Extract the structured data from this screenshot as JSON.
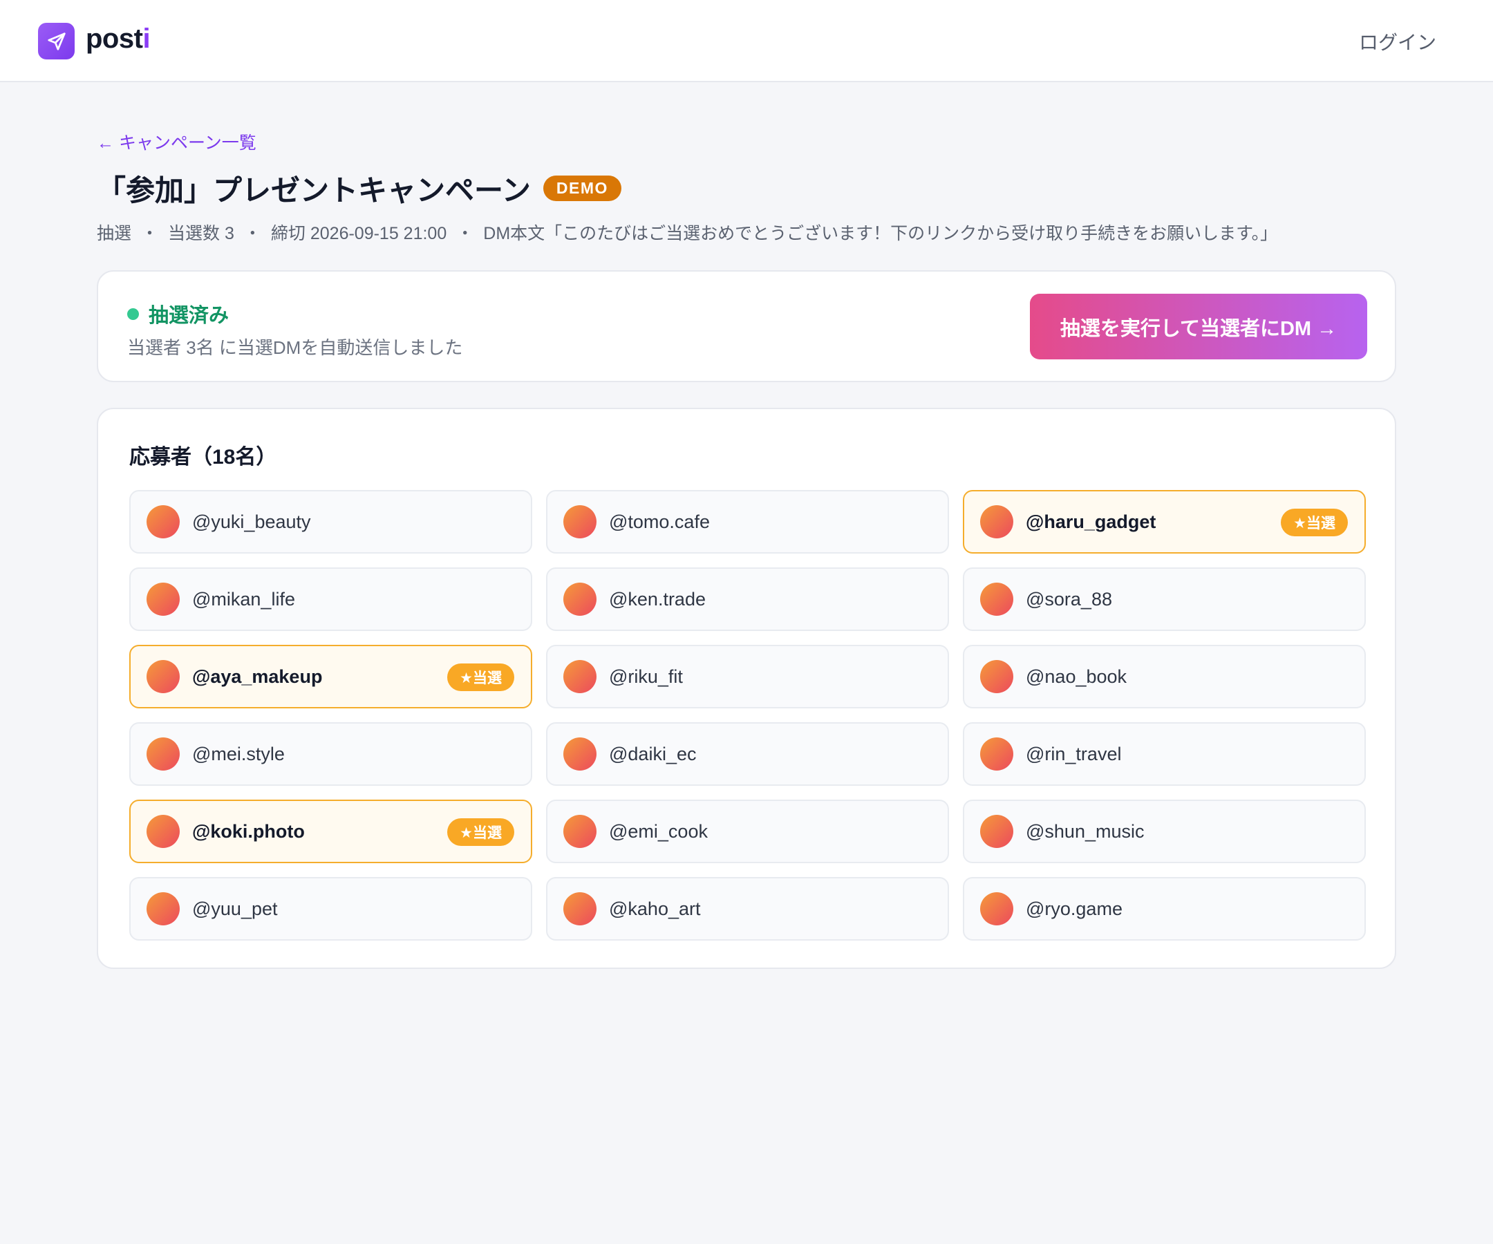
{
  "header": {
    "logo_text_main": "post",
    "logo_text_accent": "i",
    "login_label": "ログイン"
  },
  "breadcrumb": {
    "back_label": "← キャンペーン一覧"
  },
  "campaign": {
    "title": "「参加」プレゼントキャンペーン",
    "demo_badge": "DEMO",
    "type": "抽選",
    "winner_count": "当選数 3",
    "deadline": "締切 2026-09-15 21:00",
    "dm_text": "DM本文「このたびはご当選おめでとうございます！下のリンクから受け取り手続きをお願いします。」",
    "separator": "・"
  },
  "status": {
    "title": "抽選済み",
    "description": "当選者 3名 に当選DMを自動送信しました",
    "action_label": "抽選を実行して当選者にDM →",
    "color": "#34c991"
  },
  "entrants": {
    "heading": "応募者（18名）",
    "winner_badge": "★当選",
    "list": [
      {
        "handle": "@yuki_beauty",
        "winner": false
      },
      {
        "handle": "@tomo.cafe",
        "winner": false
      },
      {
        "handle": "@haru_gadget",
        "winner": true
      },
      {
        "handle": "@mikan_life",
        "winner": false
      },
      {
        "handle": "@ken.trade",
        "winner": false
      },
      {
        "handle": "@sora_88",
        "winner": false
      },
      {
        "handle": "@aya_makeup",
        "winner": true
      },
      {
        "handle": "@riku_fit",
        "winner": false
      },
      {
        "handle": "@nao_book",
        "winner": false
      },
      {
        "handle": "@mei.style",
        "winner": false
      },
      {
        "handle": "@daiki_ec",
        "winner": false
      },
      {
        "handle": "@rin_travel",
        "winner": false
      },
      {
        "handle": "@koki.photo",
        "winner": true
      },
      {
        "handle": "@emi_cook",
        "winner": false
      },
      {
        "handle": "@shun_music",
        "winner": false
      },
      {
        "handle": "@yuu_pet",
        "winner": false
      },
      {
        "handle": "@kaho_art",
        "winner": false
      },
      {
        "handle": "@ryo.game",
        "winner": false
      }
    ]
  },
  "colors": {
    "brand": "#7c3aed",
    "winner_accent": "#f9a825",
    "demo_badge": "#d97706"
  }
}
